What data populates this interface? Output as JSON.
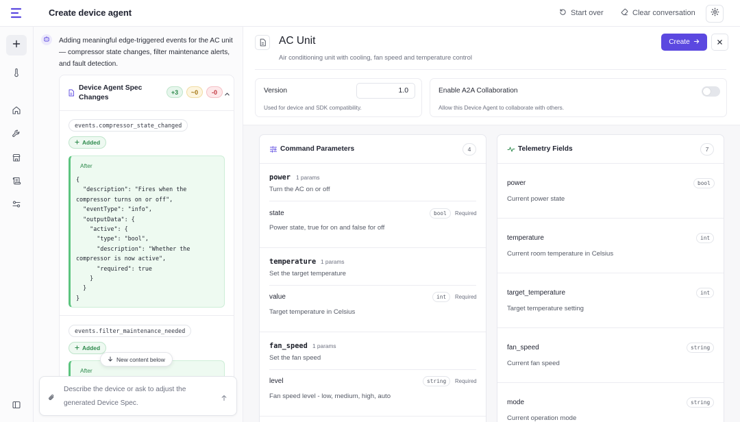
{
  "app": {
    "title": "Create device agent",
    "start_over_label": "Start over",
    "clear_label": "Clear conversation"
  },
  "chat": {
    "message": "Adding meaningful edge-triggered events for the AC unit — compressor state changes, filter maintenance alerts, and fault detection.",
    "spec_changes": {
      "title": "Device Agent Spec Changes",
      "added_count": "+3",
      "modified_count": "~0",
      "removed_count": "-0"
    },
    "events": [
      {
        "name": "events.compressor_state_changed",
        "status": "Added",
        "after_label": "After",
        "code": "{\n  \"description\": \"Fires when the\ncompressor turns on or off\",\n  \"eventType\": \"info\",\n  \"outputData\": {\n    \"active\": {\n      \"type\": \"bool\",\n      \"description\": \"Whether the\ncompressor is now active\",\n      \"required\": true\n    }\n  }\n}"
      },
      {
        "name": "events.filter_maintenance_needed",
        "status": "Added",
        "after_label": "After"
      }
    ],
    "new_content_label": "New content below",
    "input_placeholder": "Describe the device or ask to adjust the generated Device Spec."
  },
  "device": {
    "name": "AC Unit",
    "description": "Air conditioning unit with cooling, fan speed and temperature control",
    "create_label": "Create",
    "version": {
      "label": "Version",
      "value": "1.0",
      "help": "Used for device and SDK compatibility."
    },
    "a2a": {
      "label": "Enable A2A Collaboration",
      "help": "Allow this Device Agent to collaborate with others.",
      "enabled": false
    }
  },
  "commands": {
    "title": "Command Parameters",
    "count": "4",
    "items": [
      {
        "name": "power",
        "params": "1 params",
        "description": "Turn the AC on or off",
        "param": {
          "name": "state",
          "type": "bool",
          "required": "Required",
          "description": "Power state, true for on and false for off"
        }
      },
      {
        "name": "temperature",
        "params": "1 params",
        "description": "Set the target temperature",
        "param": {
          "name": "value",
          "type": "int",
          "required": "Required",
          "description": "Target temperature in Celsius"
        }
      },
      {
        "name": "fan_speed",
        "params": "1 params",
        "description": "Set the fan speed",
        "param": {
          "name": "level",
          "type": "string",
          "required": "Required",
          "description": "Fan speed level - low, medium, high, auto"
        }
      }
    ]
  },
  "telemetry": {
    "title": "Telemetry Fields",
    "count": "7",
    "items": [
      {
        "name": "power",
        "type": "bool",
        "description": "Current power state"
      },
      {
        "name": "temperature",
        "type": "int",
        "description": "Current room temperature in Celsius"
      },
      {
        "name": "target_temperature",
        "type": "int",
        "description": "Target temperature setting"
      },
      {
        "name": "fan_speed",
        "type": "string",
        "description": "Current fan speed"
      },
      {
        "name": "mode",
        "type": "string",
        "description": "Current operation mode"
      }
    ]
  }
}
